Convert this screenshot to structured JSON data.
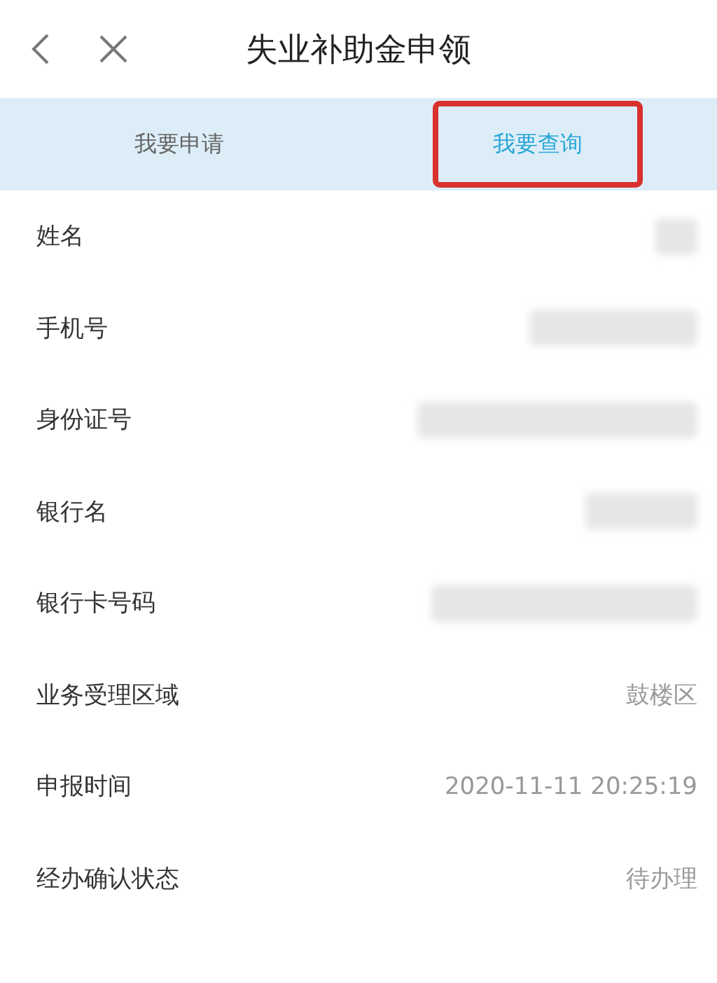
{
  "header": {
    "title": "失业补助金申领"
  },
  "tabs": [
    {
      "label": "我要申请",
      "selected": false,
      "highlighted": false
    },
    {
      "label": "我要查询",
      "selected": true,
      "highlighted": true
    }
  ],
  "fields": [
    {
      "label": "姓名",
      "kind": "redacted"
    },
    {
      "label": "手机号",
      "kind": "redacted"
    },
    {
      "label": "身份证号",
      "kind": "redacted"
    },
    {
      "label": "银行名",
      "kind": "redacted"
    },
    {
      "label": "银行卡号码",
      "kind": "redacted"
    },
    {
      "label": "业务受理区域",
      "kind": "text",
      "value": "鼓楼区"
    },
    {
      "label": "申报时间",
      "kind": "text",
      "value": "2020-11-11 20:25:19"
    },
    {
      "label": "经办确认状态",
      "kind": "text",
      "value": "待办理"
    }
  ]
}
